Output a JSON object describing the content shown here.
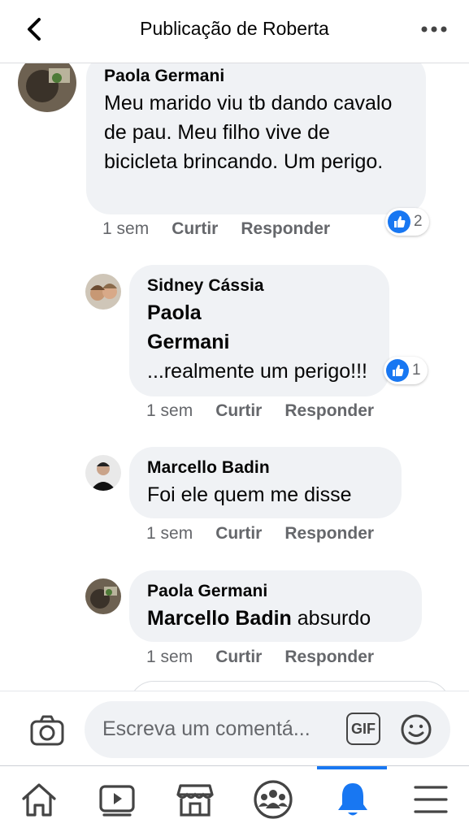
{
  "header": {
    "title": "Publicação de Roberta"
  },
  "comments": [
    {
      "author": "Paola Germani",
      "text": "Meu marido viu tb dando cavalo de pau. Meu filho vive de bicicleta brincando. Um perigo.",
      "time": "1 sem",
      "like": "Curtir",
      "reply": "Responder",
      "reactions": "2"
    },
    {
      "author": "Sidney Cássia",
      "mention": "Paola Germani",
      "text": " ...realmente um perigo!!!",
      "time": "1 sem",
      "like": "Curtir",
      "reply": "Responder",
      "reactions": "1"
    },
    {
      "author": "Marcello Badin",
      "text": "Foi ele quem me disse",
      "time": "1 sem",
      "like": "Curtir",
      "reply": "Responder"
    },
    {
      "author": "Paola Germani",
      "mention": "Marcello Badin",
      "text": " absurdo",
      "time": "1 sem",
      "like": "Curtir",
      "reply": "Responder"
    }
  ],
  "composer": {
    "placeholder": "Escreva um comentá...",
    "gif": "GIF"
  },
  "nav": {
    "items": [
      "home-icon",
      "watch-icon",
      "marketplace-icon",
      "groups-icon",
      "notifications-icon",
      "menu-icon"
    ],
    "active": "notifications-icon"
  },
  "colors": {
    "accent": "#1877f2",
    "bubble": "#f0f2f5",
    "meta": "#65676b"
  }
}
